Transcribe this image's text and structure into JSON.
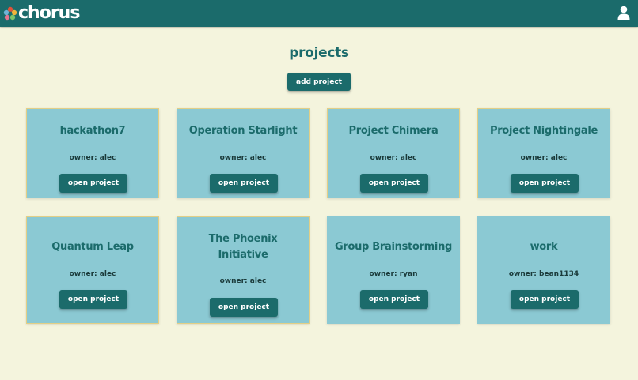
{
  "header": {
    "brand": "chorus",
    "logo_icon": "flower-logo-icon",
    "user_icon": "user-profile-icon"
  },
  "main": {
    "title": "projects",
    "add_button": "add project",
    "owner_prefix": "owner: ",
    "open_label": "open project",
    "projects": [
      {
        "name": "hackathon7",
        "owner": "owner: alec"
      },
      {
        "name": "Operation Starlight",
        "owner": "owner: alec"
      },
      {
        "name": "Project Chimera",
        "owner": "owner: alec"
      },
      {
        "name": "Project Nightingale",
        "owner": "owner: alec"
      },
      {
        "name": "Quantum Leap",
        "owner": "owner: alec"
      },
      {
        "name": "The Phoenix Initiative",
        "owner": "owner: alec"
      },
      {
        "name": "Group Brainstorming",
        "owner": "owner: ryan"
      },
      {
        "name": "work",
        "owner": "owner: bean1134"
      }
    ]
  },
  "colors": {
    "header_bg": "#1b6b6b",
    "page_bg": "#f4f4dd",
    "card_bg": "#8bc9d3",
    "card_border": "#e2cf86",
    "accent_text": "#1b6b6b"
  }
}
